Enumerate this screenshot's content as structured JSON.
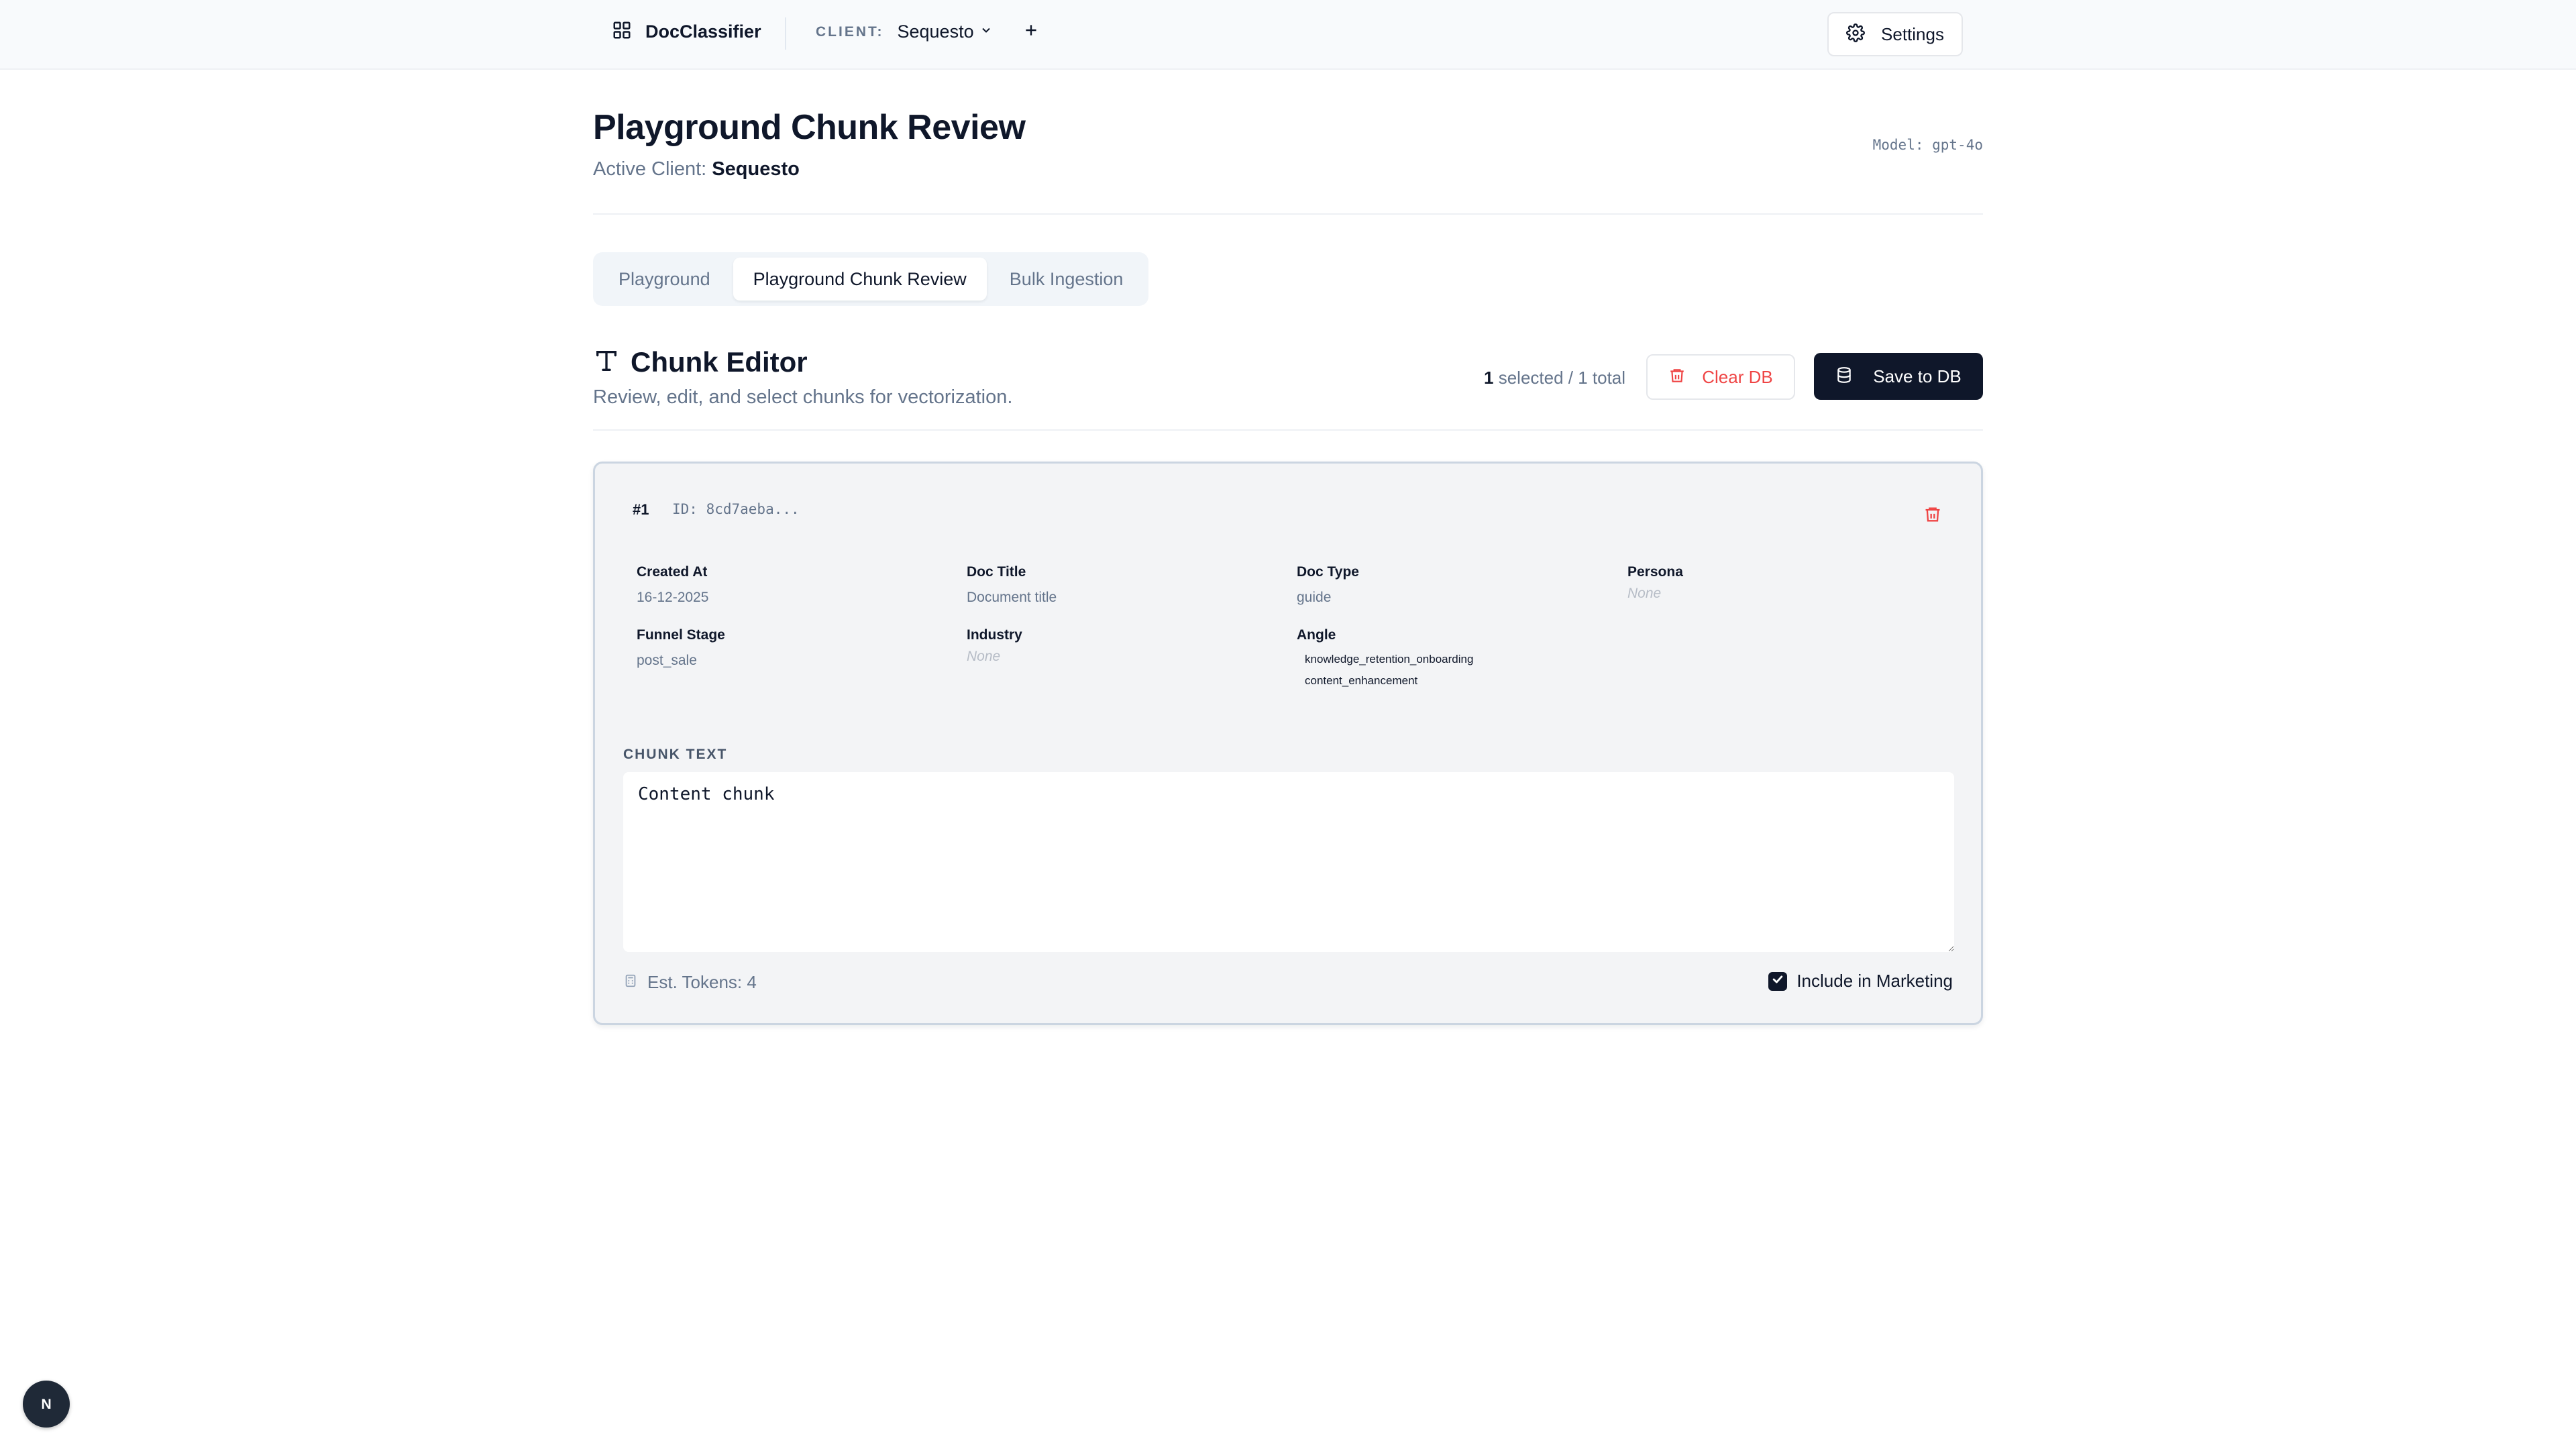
{
  "app": {
    "name": "DocClassifier",
    "client_label": "CLIENT:",
    "client_value": "Sequesto",
    "settings_label": "Settings",
    "badge_letter": "N"
  },
  "header": {
    "title": "Playground Chunk Review",
    "active_client_prefix": "Active Client:",
    "active_client_value": "Sequesto",
    "model": "Model: gpt-4o"
  },
  "tabs": [
    {
      "label": "Playground",
      "active": false
    },
    {
      "label": "Playground Chunk Review",
      "active": true
    },
    {
      "label": "Bulk Ingestion",
      "active": false
    }
  ],
  "editor": {
    "title": "Chunk Editor",
    "subtitle": "Review, edit, and select chunks for vectorization.",
    "selected_count": "1",
    "selected_suffix": "selected / 1 total",
    "clear_label": "Clear DB",
    "save_label": "Save to DB"
  },
  "chunk": {
    "number": "#1",
    "id": "ID: 8cd7aeba...",
    "created_at_label": "Created At",
    "created_at_value": "16-12-2025",
    "doc_title_label": "Doc Title",
    "doc_title_value": "Document title",
    "doc_type_label": "Doc Type",
    "doc_type_value": "guide",
    "persona_label": "Persona",
    "persona_value": "None",
    "funnel_stage_label": "Funnel Stage",
    "funnel_stage_value": "post_sale",
    "industry_label": "Industry",
    "industry_value": "None",
    "angle_label": "Angle",
    "angle_values": [
      "knowledge_retention_onboarding",
      "content_enhancement"
    ],
    "text_label": "CHUNK TEXT",
    "text": "Content chunk",
    "tokens": "Est. Tokens: 4",
    "include_label": "Include in Marketing",
    "include_checked": true
  }
}
